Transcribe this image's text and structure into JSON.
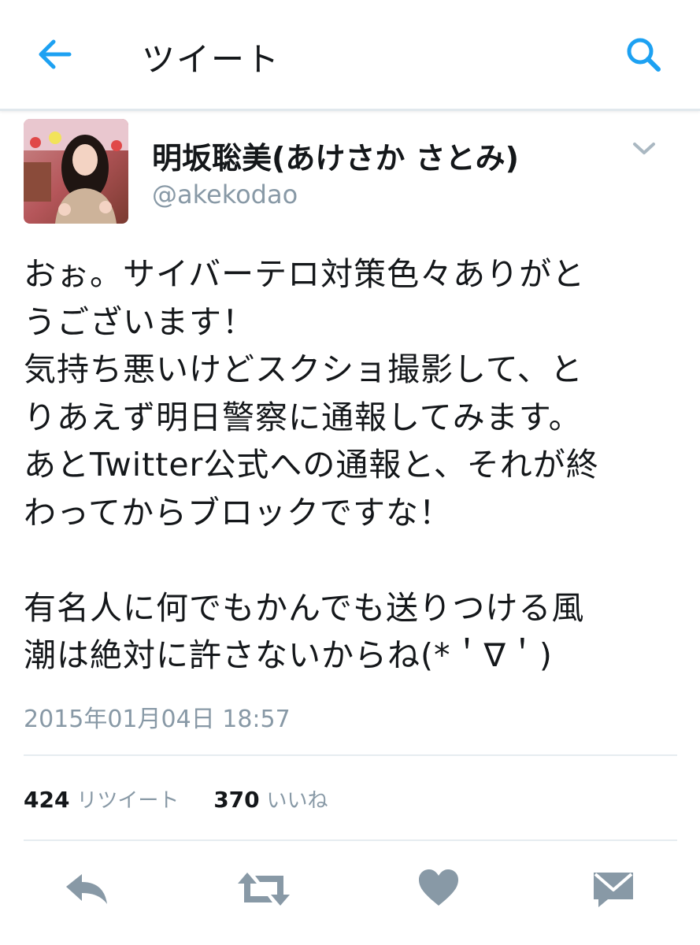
{
  "header": {
    "title": "ツイート",
    "back_icon": "arrow-left-icon",
    "search_icon": "search-icon",
    "accent_color": "#1da1f2"
  },
  "tweet": {
    "display_name": "明坂聡美(あけさか さとみ)",
    "handle": "@akekodao",
    "text": "おぉ。サイバーテロ対策色々ありがと\nうございます！\n気持ち悪いけどスクショ撮影して、と\nりあえず明日警察に通報してみます。\nあとTwitter公式への通報と、それが終\nわってからブロックですな！\n\n有名人に何でもかんでも送りつける風\n潮は絶対に許さないからね(*＇∇＇)",
    "timestamp": "2015年01月04日 18:57",
    "retweet_count": "424",
    "retweet_label": "リツイート",
    "like_count": "370",
    "like_label": "いいね"
  },
  "actions": [
    {
      "icon": "reply-icon"
    },
    {
      "icon": "retweet-icon"
    },
    {
      "icon": "heart-icon"
    },
    {
      "icon": "direct-message-icon"
    }
  ],
  "colors": {
    "icon_gray": "#8899a6",
    "text_dark": "#14171a",
    "divider": "#e6ecf0"
  }
}
